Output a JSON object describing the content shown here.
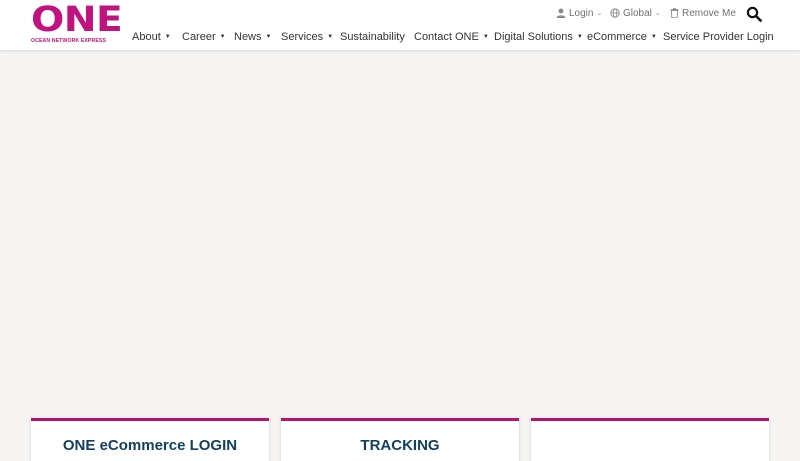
{
  "brand": {
    "logo_text": "ONE",
    "tagline": "OCEAN NETWORK EXPRESS",
    "color": "#c0137f"
  },
  "utility": {
    "login": "Login",
    "global": "Global",
    "remove_me": "Remove Me"
  },
  "nav": {
    "about": "About",
    "career": "Career",
    "news": "News",
    "services": "Services",
    "sustainability": "Sustainability",
    "contact": "Contact ONE",
    "digital": "Digital Solutions",
    "ecommerce": "eCommerce",
    "provider_login": "Service Provider Login"
  },
  "cards": {
    "ecommerce_login": "ONE eCommerce LOGIN",
    "tracking": "TRACKING",
    "third": ""
  },
  "colors": {
    "accent": "#b3146f",
    "card_title": "#14405f",
    "background": "#f5f4f2"
  }
}
